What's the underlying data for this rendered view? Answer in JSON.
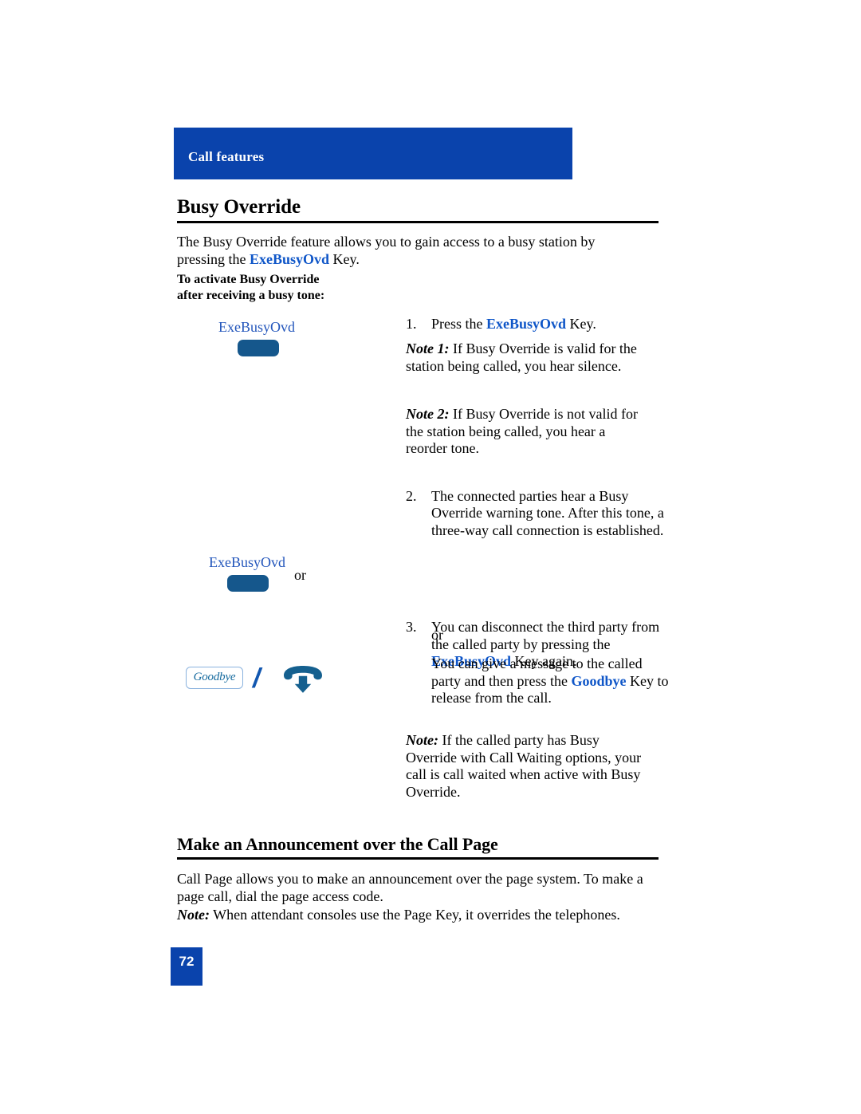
{
  "running_header": {
    "label": "Call features",
    "band_color": "#0a43ac"
  },
  "sections": {
    "busy_override": {
      "heading": "Busy Override",
      "intro_before": "The Busy Override feature allows you to gain access to a busy station by pressing the ",
      "intro_keyword": "ExeBusyOvd",
      "intro_after": " Key.",
      "subhead_line1": "To activate Busy Override",
      "subhead_line2": "after receiving a busy tone:"
    },
    "call_page": {
      "heading": "Make an Announcement over the Call Page",
      "para1": "Call Page allows you to make an announcement over the page system. To make a page call, dial the page access code.",
      "note_lead": "Note:",
      "note_text": " When attendant consoles use the Page Key, it overrides the telephones."
    }
  },
  "key_graphics": {
    "key1_label": "ExeBusyOvd",
    "key2_label": "ExeBusyOvd",
    "or_inline": "or",
    "goodbye_label": "Goodbye",
    "slash": "/",
    "handset_icon_name": "release-handset-icon"
  },
  "steps": {
    "step1": {
      "number": "1.",
      "before": "Press the ",
      "keyword": "ExeBusyOvd",
      "after": " Key."
    },
    "note1": {
      "lead": "Note 1:",
      "text": " If Busy Override is valid for the station being called, you hear silence."
    },
    "note2": {
      "lead": "Note 2:",
      "text": " If Busy Override is not valid for the station being called, you hear a reorder tone."
    },
    "step2": {
      "number": "2.",
      "text": "The connected parties hear a Busy Override warning tone. After this tone, a three-way call connection is established."
    },
    "step3": {
      "number": "3.",
      "before": "You can disconnect the third party from the called party by pressing the ",
      "keyword": "ExeBusyOvd",
      "after": " Key again."
    },
    "or_text": "or",
    "alt": {
      "before": "You can give a message to the called party and then press the ",
      "keyword": "Goodbye",
      "after": " Key to release from the call",
      "period": "."
    },
    "note3": {
      "lead": "Note:",
      "text": " If the called party has Busy Override with Call Waiting options, your call is call waited when active with Busy Override."
    }
  },
  "footer": {
    "page_number": "72"
  },
  "colors": {
    "brand_blue": "#0a43ac",
    "keyword_blue": "#0f56c8",
    "keycap_blue": "#15578c",
    "key_label_blue": "#2255bb",
    "goodbye_text_blue": "#156a9e"
  }
}
